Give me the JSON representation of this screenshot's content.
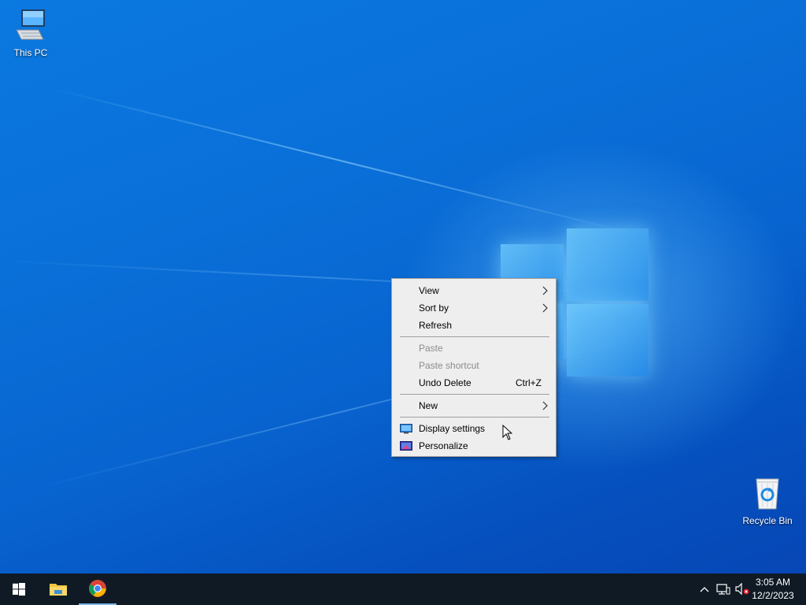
{
  "desktop": {
    "icons": [
      {
        "label": "This PC",
        "icon": "this-pc-icon"
      },
      {
        "label": "Recycle Bin",
        "icon": "recycle-bin-icon"
      }
    ]
  },
  "context_menu": {
    "view": "View",
    "sort_by": "Sort by",
    "refresh": "Refresh",
    "paste": "Paste",
    "paste_shortcut": "Paste shortcut",
    "undo_delete": "Undo Delete",
    "undo_delete_shortcut": "Ctrl+Z",
    "new": "New",
    "display_settings": "Display settings",
    "personalize": "Personalize"
  },
  "taskbar": {
    "apps": [
      "start-icon",
      "file-explorer-icon",
      "chrome-icon"
    ],
    "tray_icons": [
      "show-hidden-icons-chevron",
      "network-icon",
      "volume-muted-icon"
    ],
    "clock": {
      "time": "3:05 AM",
      "date": "12/2/2023"
    }
  },
  "colors": {
    "desktop_blue": "#0a6fd8",
    "taskbar": "#0f1a24",
    "menu_bg": "#eeeeee",
    "disabled_text": "#8c8c8c"
  }
}
